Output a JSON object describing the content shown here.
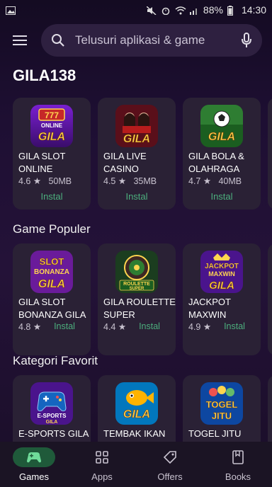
{
  "status_bar": {
    "battery": "88%",
    "time": "14:30"
  },
  "search": {
    "placeholder": "Telusuri aplikasi & game"
  },
  "sections": {
    "brand": "GILA138",
    "popular": "Game Populer",
    "favorite": "Kategori Favorit"
  },
  "row1": [
    {
      "line1": "GILA SLOT",
      "line2": "ONLINE",
      "rating": "4.6 ★",
      "size": "50MB",
      "install": "Instal",
      "icon_text": "GILA",
      "icon_sub": "777 ONLINE"
    },
    {
      "line1": "GILA LIVE",
      "line2": "CASINO",
      "rating": "4.5 ★",
      "size": "35MB",
      "install": "Instal",
      "icon_text": "GILA"
    },
    {
      "line1": "GILA BOLA &",
      "line2": "OLAHRAGA",
      "rating": "4.7 ★",
      "size": "40MB",
      "install": "Instal",
      "icon_text": "GILA"
    }
  ],
  "row2": [
    {
      "line1": "GILA SLOT",
      "line2": "BONANZA GILA",
      "rating": "4.8 ★",
      "install": "Instal",
      "icon_text": "GILA",
      "icon_sub": "SLOT BONANZA"
    },
    {
      "line1": "GILA ROULETTE",
      "line2": "SUPER",
      "rating": "4.4 ★",
      "install": "Instal",
      "icon_text": "ROULETTE SUPER"
    },
    {
      "line1": "JACKPOT",
      "line2": "MAXWIN",
      "rating": "4.9 ★",
      "install": "Instal",
      "icon_text": "GILA",
      "icon_sub": "JACKPOT MAXWIN"
    }
  ],
  "row3": [
    {
      "line1": "E-SPORTS GILA",
      "icon_text": "E-SPORTS GILA"
    },
    {
      "line1": "TEMBAK IKAN",
      "icon_text": "GILA"
    },
    {
      "line1": "TOGEL JITU",
      "icon_text": "TOGEL JITU"
    }
  ],
  "nav": {
    "games": "Games",
    "apps": "Apps",
    "offers": "Offers",
    "books": "Books"
  },
  "colors": {
    "accent_green": "#4caf7d",
    "nav_active": "#1f5a3a",
    "card_bg": "#2a2135"
  }
}
